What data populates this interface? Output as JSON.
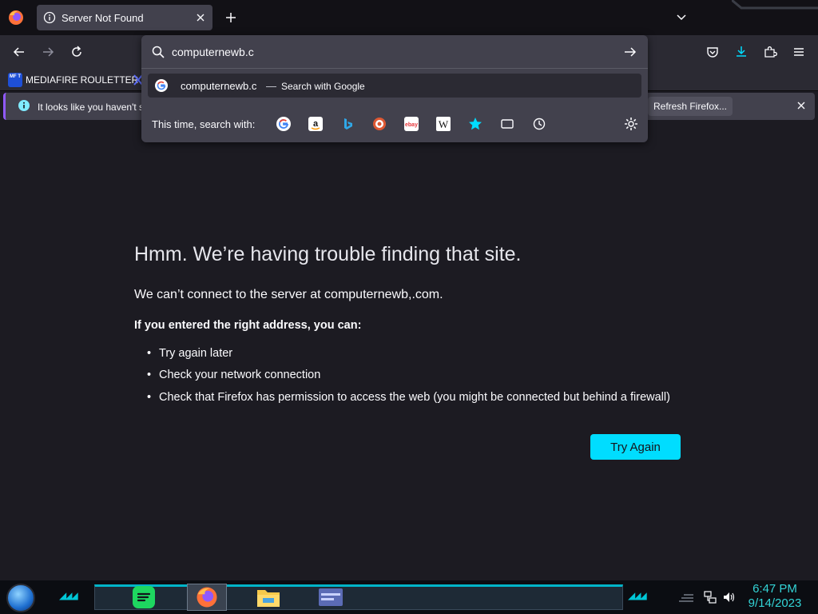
{
  "browser": {
    "tab": {
      "title": "Server Not Found"
    },
    "urlbar": {
      "value": "computernewb.c"
    },
    "suggestion": {
      "query": "computernewb.c",
      "separator": "—",
      "action": "Search with Google"
    },
    "oneoff_label": "This time, search with:",
    "engines": [
      "google-icon",
      "amazon-icon",
      "bing-icon",
      "duckduckgo-icon",
      "ebay-icon",
      "wikipedia-icon",
      "bookmarks-star-icon",
      "tabs-icon",
      "history-icon"
    ],
    "bookmarks": [
      {
        "label": "MEDIAFIRE ROULETTER",
        "icon_text": "MF T"
      }
    ],
    "notification": {
      "text": "It looks like you haven't st",
      "button": "Refresh Firefox..."
    }
  },
  "page": {
    "title": "Hmm. We’re having trouble finding that site.",
    "description": "We can’t connect to the server at computernewb,.com.",
    "subtitle": "If you entered the right address, you can:",
    "suggestions": [
      "Try again later",
      "Check your network connection",
      "Check that Firefox has permission to access the web (you might be connected but behind a firewall)"
    ],
    "button": "Try Again"
  },
  "taskbar": {
    "time": "6:47 PM",
    "date": "9/14/2023",
    "apps": [
      "spotify-icon",
      "firefox-icon",
      "file-explorer-icon",
      "window-icon"
    ]
  },
  "colors": {
    "accent": "#00ddff",
    "content_bg": "#1c1b22",
    "toolbar_bg": "#2b2a33",
    "panel_bg": "#42414d",
    "clock": "#33d4d6"
  }
}
